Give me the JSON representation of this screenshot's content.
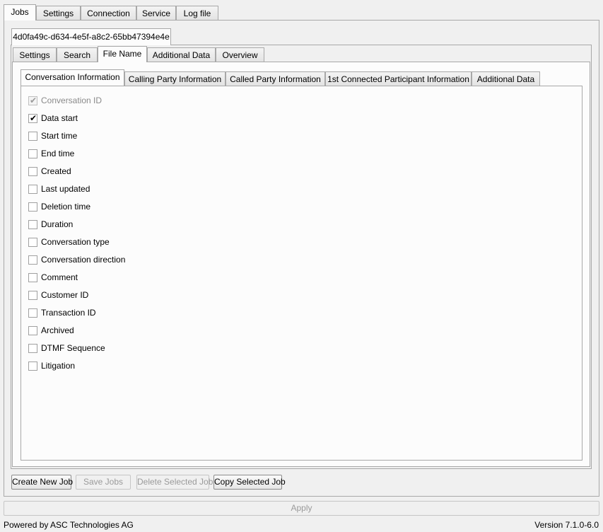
{
  "main_tabs": [
    "Jobs",
    "Settings",
    "Connection",
    "Service",
    "Log file"
  ],
  "job_tab": "4d0fa49c-d634-4e5f-a8c2-65bb47394e4e",
  "job_sub_tabs": [
    "Settings",
    "Search",
    "File Name",
    "Additional Data",
    "Overview"
  ],
  "filename_tabs": [
    "Conversation Information",
    "Calling Party Information",
    "Called Party Information",
    "1st Connected Participant Information",
    "Additional Data"
  ],
  "fields": [
    {
      "label": "Conversation ID",
      "checked": true,
      "disabled": true
    },
    {
      "label": "Data start",
      "checked": true,
      "disabled": false
    },
    {
      "label": "Start time",
      "checked": false,
      "disabled": false
    },
    {
      "label": "End time",
      "checked": false,
      "disabled": false
    },
    {
      "label": "Created",
      "checked": false,
      "disabled": false
    },
    {
      "label": "Last updated",
      "checked": false,
      "disabled": false
    },
    {
      "label": "Deletion time",
      "checked": false,
      "disabled": false
    },
    {
      "label": "Duration",
      "checked": false,
      "disabled": false
    },
    {
      "label": "Conversation type",
      "checked": false,
      "disabled": false
    },
    {
      "label": "Conversation direction",
      "checked": false,
      "disabled": false
    },
    {
      "label": "Comment",
      "checked": false,
      "disabled": false
    },
    {
      "label": "Customer ID",
      "checked": false,
      "disabled": false
    },
    {
      "label": "Transaction ID",
      "checked": false,
      "disabled": false
    },
    {
      "label": "Archived",
      "checked": false,
      "disabled": false
    },
    {
      "label": "DTMF Sequence",
      "checked": false,
      "disabled": false
    },
    {
      "label": "Litigation",
      "checked": false,
      "disabled": false
    }
  ],
  "buttons": {
    "create_new_job": "Create New Job",
    "save_jobs": "Save Jobs",
    "delete_selected_job": "Delete Selected Job",
    "copy_selected_job": "Copy Selected Job",
    "apply": "Apply"
  },
  "status": {
    "powered_by": "Powered by ASC Technologies AG",
    "version": "Version 7.1.0-6.0"
  }
}
